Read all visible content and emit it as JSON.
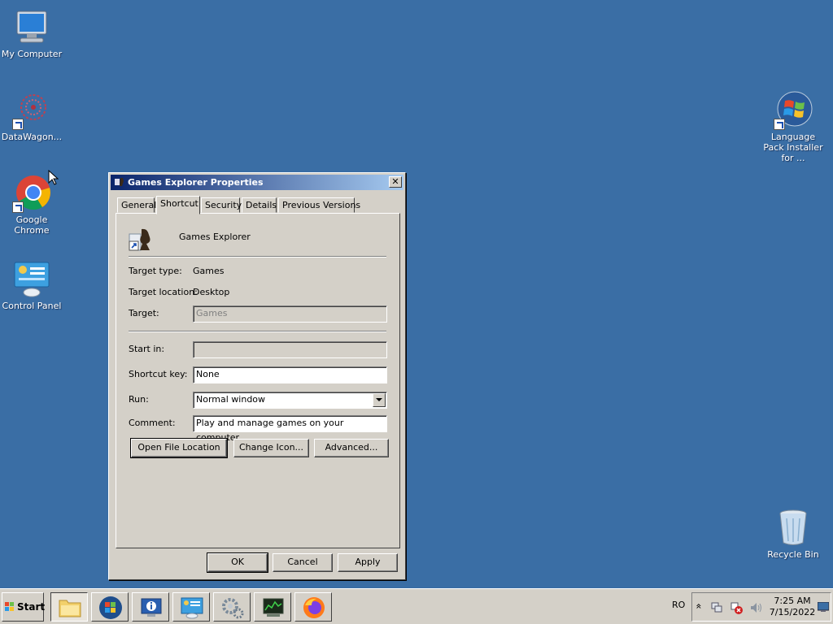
{
  "desktop": {
    "icons": [
      {
        "label": "My Computer"
      },
      {
        "label": "DataWagon..."
      },
      {
        "label": "Google Chrome"
      },
      {
        "label": "Control Panel"
      },
      {
        "label": "Language Pack Installer for ..."
      },
      {
        "label": "Recycle Bin"
      }
    ]
  },
  "dialog": {
    "title": "Games Explorer Properties",
    "close_glyph": "✕",
    "tabs": [
      "General",
      "Shortcut",
      "Security",
      "Details",
      "Previous Versions"
    ],
    "active_tab": "Shortcut",
    "app_name": "Games Explorer",
    "target_type_label": "Target type:",
    "target_type_value": "Games",
    "target_location_label": "Target location:",
    "target_location_value": "Desktop",
    "target_label": "Target:",
    "target_value": "Games",
    "start_in_label": "Start in:",
    "start_in_value": "",
    "shortcut_key_label": "Shortcut key:",
    "shortcut_key_value": "None",
    "run_label": "Run:",
    "run_value": "Normal window",
    "comment_label": "Comment:",
    "comment_value": "Play and manage games on your computer.",
    "open_file_location": "Open File Location",
    "change_icon": "Change Icon...",
    "advanced": "Advanced...",
    "ok": "OK",
    "cancel": "Cancel",
    "apply": "Apply"
  },
  "taskbar": {
    "start_label": "Start",
    "language": "RO",
    "time": "7:25 AM",
    "date": "7/15/2022",
    "tray_chevron": "»"
  },
  "colors": {
    "desktop": "#3a6ea5",
    "window_face": "#d4d0c8",
    "titlebar_start": "#0a246a",
    "titlebar_end": "#a6caf0"
  }
}
